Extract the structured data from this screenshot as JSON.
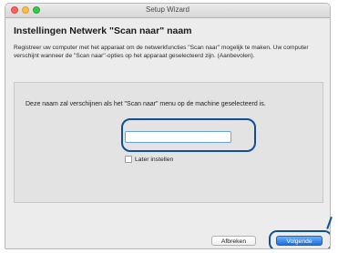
{
  "window": {
    "title": "Setup Wizard"
  },
  "page": {
    "heading": "Instellingen Netwerk \"Scan naar\" naam",
    "intro": "Registreer uw computer met het apparaat om de netwerkfuncties \"Scan naar\" mogelijk te maken. Uw computer verschijnt wanneer de \"Scan naar\"-opties op het apparaat geselecteerd zijn. (Aanbevolen)."
  },
  "panel": {
    "prompt": "Deze naam zal verschijnen als het \"Scan naar\" menu op de machine geselecteerd is.",
    "name_value": "",
    "later_label": "Later instellen",
    "later_checked": false
  },
  "buttons": {
    "cancel": "Afbreken",
    "next": "Volgende"
  },
  "colors": {
    "callout": "#0e4f96",
    "primary": "#1b6fe0"
  }
}
